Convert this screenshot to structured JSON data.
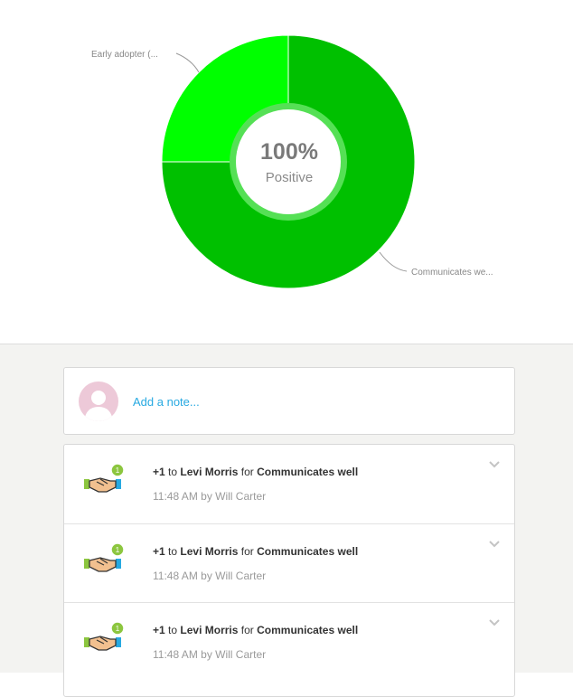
{
  "chart_data": {
    "type": "pie",
    "style": "donut",
    "categories": [
      "Early adopter (...",
      "Communicates we..."
    ],
    "values": [
      25,
      75
    ],
    "colors": [
      "#00ff00",
      "#00c000"
    ],
    "center_value": "100%",
    "center_label": "Positive"
  },
  "note": {
    "placeholder": "Add a note..."
  },
  "feed": {
    "items": [
      {
        "badge": "1",
        "points": "+1",
        "to": "to",
        "person": "Levi Morris",
        "for": "for",
        "skill": "Communicates well",
        "meta": "11:48 AM by Will Carter"
      },
      {
        "badge": "1",
        "points": "+1",
        "to": "to",
        "person": "Levi Morris",
        "for": "for",
        "skill": "Communicates well",
        "meta": "11:48 AM by Will Carter"
      },
      {
        "badge": "1",
        "points": "+1",
        "to": "to",
        "person": "Levi Morris",
        "for": "for",
        "skill": "Communicates well",
        "meta": "11:48 AM by Will Carter"
      }
    ]
  },
  "colors": {
    "accent": "#27a9e1",
    "badge": "#8cc63f"
  }
}
